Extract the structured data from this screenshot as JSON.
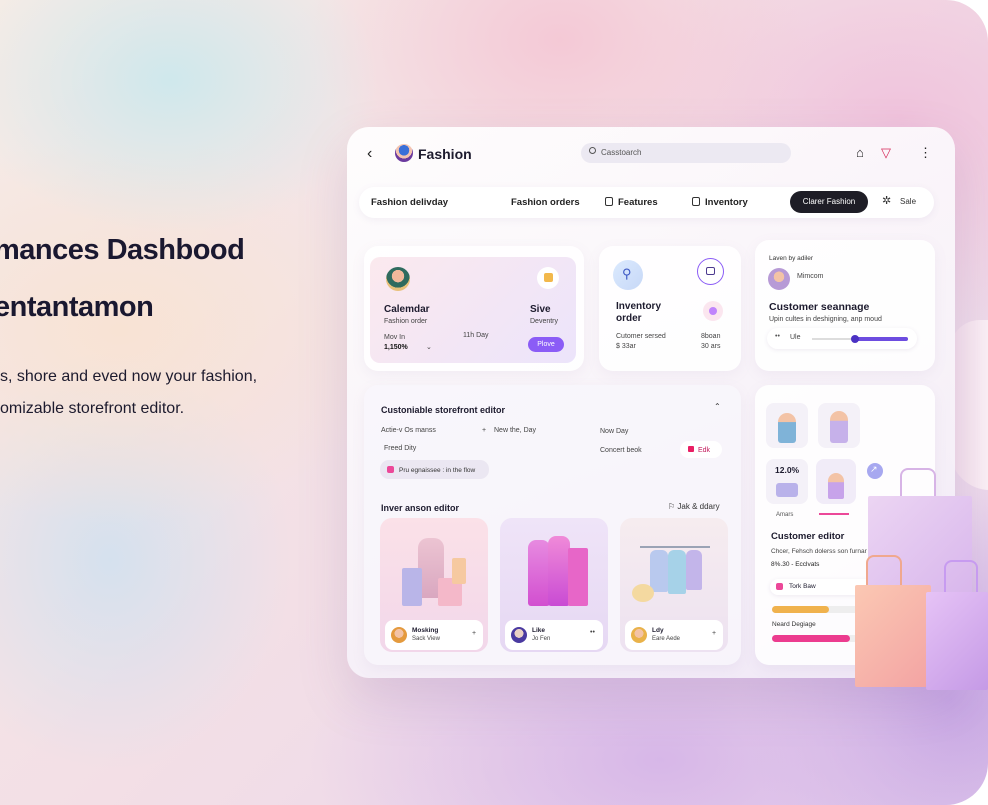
{
  "hero": {
    "title1": "mances Dashbood",
    "title2": "entantamon",
    "p1": "s, shore and eved now your fashion,",
    "p2": "omizable storefront editor."
  },
  "topbar": {
    "back": "‹",
    "brand": "Fashion",
    "search": "Casstoarch",
    "icons": [
      "home-icon",
      "filter-icon",
      "more-icon"
    ]
  },
  "tabs": {
    "t1": "Fashion delivday",
    "t2": "Fashion orders",
    "t3": "Features",
    "t4": "Inventory",
    "btn": "Clarer Fashion",
    "sale": "Sale"
  },
  "cal": {
    "title": "Calemdar",
    "sub": "Fashion order",
    "t2": "Sive",
    "s2": "Deventry",
    "l1": "Mov In",
    "l2": "1,150%",
    "l3": "11h Day",
    "btn": "Plove"
  },
  "inv": {
    "title1": "Inventory",
    "title2": "order",
    "l1": "Cutomer sersed",
    "l2": "$ 33ar",
    "r1": "8boan",
    "r2": "30 ars"
  },
  "cust": {
    "small": "Laven by adiler",
    "name": "Mimcom",
    "title": "Customer seannage",
    "desc": "Upin cultes in deshigning, anp moud",
    "slider_label": "Ule",
    "slider_value": 0.45
  },
  "store": {
    "title": "Custoniable storefront editor",
    "r1a": "Actie-v Os manss",
    "r1b": "New the, Day",
    "r1c": "Now Day",
    "r2a": "Freed Dity",
    "r2b": "Concert beok",
    "edit": "Edk",
    "chip": "Pru egnaissee : in the flow",
    "sub": "Inver anson editor",
    "subright": "Jak & ddary",
    "products": [
      {
        "name": "Mosking",
        "sub": "Sack View"
      },
      {
        "name": "Like",
        "sub": "Jo Fen"
      },
      {
        "name": "Ldy",
        "sub": "Eare Aede"
      }
    ]
  },
  "right": {
    "stat": "12.0%",
    "stat_label": "Amars",
    "title": "Customer editor",
    "desc": "Chcer, Fehsch dolerss son furnar",
    "price": "8%.30 - Ecclvats",
    "task": "Tork Baw",
    "bar_label": "Neard Degiage",
    "bar1": 0.55,
    "bar2": 0.75
  },
  "colors": {
    "accent": "#8b5cf6",
    "dark": "#1e1d26",
    "pink": "#ec4899"
  }
}
